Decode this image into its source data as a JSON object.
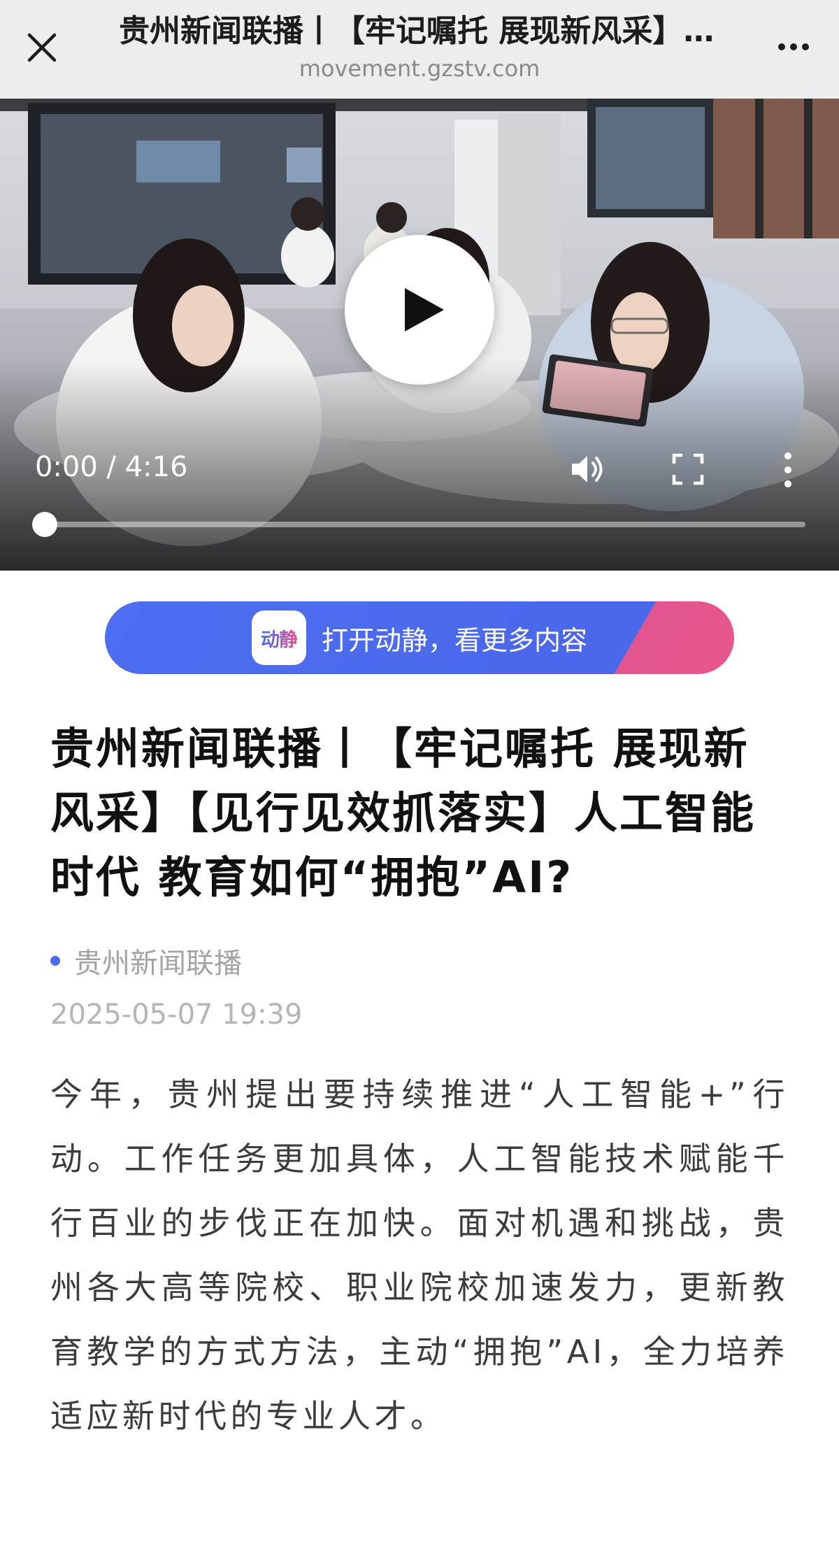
{
  "topbar": {
    "title": "贵州新闻联播丨【牢记嘱托 展现新风采】【见行见效抓落实】人工智能时代 教育如何“拥抱”AI?",
    "url": "movement.gzstv.com",
    "close_icon": "close-icon",
    "more_icon": "more-horizontal-icon"
  },
  "video": {
    "time_display": "0:00 / 4:16",
    "progress": 0,
    "play_icon": "play-icon",
    "volume_icon": "volume-icon",
    "fullscreen_icon": "fullscreen-icon",
    "more_icon": "more-vertical-icon"
  },
  "open_app": {
    "logo_text": "动静",
    "label": "打开动静，看更多内容",
    "colors": {
      "primary": "#4c6ef0",
      "accent": "#e8578c"
    }
  },
  "article": {
    "title": "贵州新闻联播丨【牢记嘱托 展现新风采】【见行见效抓落实】人工智能时代 教育如何“拥抱”AI?",
    "source": "贵州新闻联播",
    "publish_time": "2025-05-07 19:39",
    "body": "今年，贵州提出要持续推进“人工智能+”行动。工作任务更加具体，人工智能技术赋能千行百业的步伐正在加快。面对机遇和挑战，贵州各大高等院校、职业院校加速发力，更新教育教学的方式方法，主动“拥抱”AI，全力培养适应新时代的专业人才。",
    "source_dot_color": "#4d6cf1"
  }
}
